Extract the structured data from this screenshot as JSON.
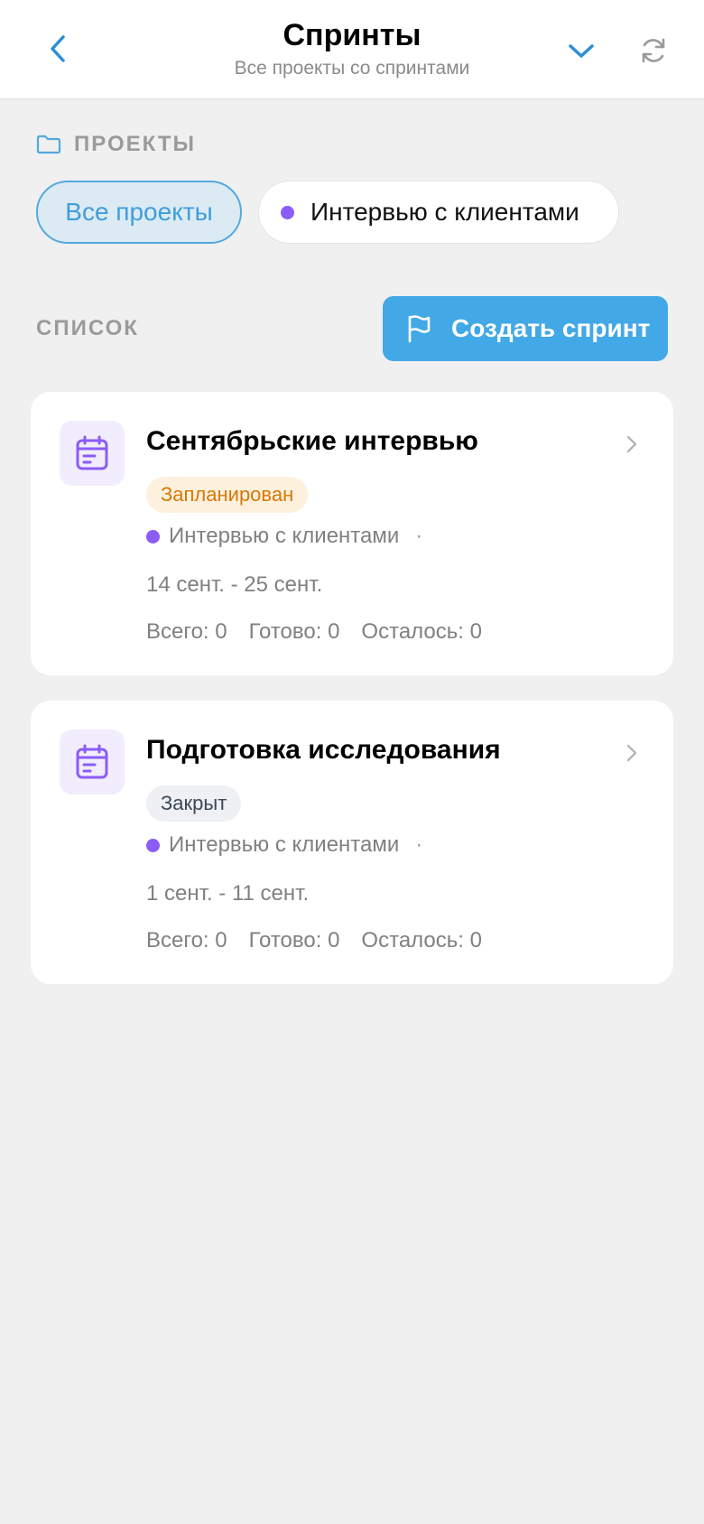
{
  "header": {
    "title": "Спринты",
    "subtitle": "Все проекты со спринтами"
  },
  "projects_section": {
    "label": "ПРОЕКТЫ",
    "chips": [
      {
        "label": "Все проекты",
        "selected": true
      },
      {
        "label": "Интервью с клиентами",
        "selected": false,
        "dot_color": "#8b5cf6"
      }
    ]
  },
  "list_section": {
    "label": "СПИСОК",
    "create_button": "Создать спринт"
  },
  "sprints": [
    {
      "name": "Сентябрьские интервью",
      "status": "Запланирован",
      "project": "Интервью с клиентами",
      "separator": "·",
      "dates": "14 сент. - 25 сент.",
      "total": "Всего: 0",
      "done": "Готово: 0",
      "left": "Осталось: 0"
    },
    {
      "name": "Подготовка исследования",
      "status": "Закрыт",
      "project": "Интервью с клиентами",
      "separator": "·",
      "dates": "1 сент. - 11 сент.",
      "total": "Всего: 0",
      "done": "Готово: 0",
      "left": "Осталось: 0"
    }
  ],
  "colors": {
    "accent": "#43a8e6",
    "project_dot": "#8b5cf6",
    "planned_text": "#d97706",
    "planned_bg": "#fdf1de",
    "closed_text": "#3c4757",
    "closed_bg": "#eef0f3"
  },
  "icons": {
    "back": "chevron-left-icon",
    "dropdown": "chevron-down-icon",
    "refresh": "refresh-icon",
    "folder": "folder-icon",
    "flag": "flag-icon",
    "calendar": "calendar-icon",
    "card_chevron": "chevron-right-icon"
  }
}
